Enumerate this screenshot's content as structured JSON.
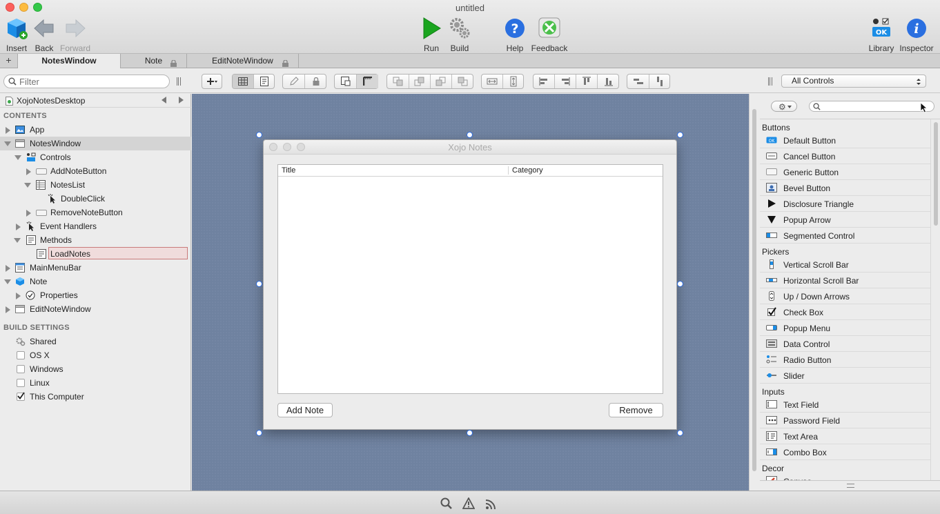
{
  "window": {
    "title": "untitled"
  },
  "toolbar": {
    "insert": "Insert",
    "back": "Back",
    "forward": "Forward",
    "run": "Run",
    "build": "Build",
    "help": "Help",
    "feedback": "Feedback",
    "library": "Library",
    "inspector": "Inspector"
  },
  "tabs": {
    "add": "+",
    "items": [
      {
        "label": "NotesWindow",
        "active": true,
        "locked": false
      },
      {
        "label": "Note",
        "active": false,
        "locked": true
      },
      {
        "label": "EditNoteWindow",
        "active": false,
        "locked": true
      }
    ]
  },
  "filter": {
    "placeholder": "Filter",
    "value": ""
  },
  "library_filter": {
    "selected": "All Controls"
  },
  "navigator": {
    "project": "XojoNotesDesktop",
    "contents_title": "CONTENTS",
    "rows": [
      "App",
      "NotesWindow",
      "Controls",
      "AddNoteButton",
      "NotesList",
      "DoubleClick",
      "RemoveNoteButton",
      "Event Handlers",
      "Methods",
      "LoadNotes",
      "MainMenuBar",
      "Note",
      "Properties",
      "EditNoteWindow"
    ],
    "build_title": "BUILD SETTINGS",
    "build": [
      {
        "label": "Shared"
      },
      {
        "label": "OS X",
        "checked": false
      },
      {
        "label": "Windows",
        "checked": false
      },
      {
        "label": "Linux",
        "checked": false
      },
      {
        "label": "This Computer",
        "checked": true
      }
    ]
  },
  "form": {
    "title": "Xojo Notes",
    "columns": [
      "Title",
      "Category"
    ],
    "add_button": "Add Note",
    "remove_button": "Remove"
  },
  "library": {
    "search_value": "",
    "categories": [
      {
        "name": "Buttons",
        "items": [
          "Default Button",
          "Cancel Button",
          "Generic Button",
          "Bevel Button",
          "Disclosure Triangle",
          "Popup Arrow",
          "Segmented Control"
        ]
      },
      {
        "name": "Pickers",
        "items": [
          "Vertical Scroll Bar",
          "Horizontal Scroll Bar",
          "Up / Down Arrows",
          "Check Box",
          "Popup Menu",
          "Data Control",
          "Radio Button",
          "Slider"
        ]
      },
      {
        "name": "Inputs",
        "items": [
          "Text Field",
          "Password Field",
          "Text Area",
          "Combo Box"
        ]
      },
      {
        "name": "Decor",
        "items": [
          "Canvas"
        ]
      }
    ]
  },
  "colors": {
    "canvas": "#6f82a0",
    "selection_handle": "#2c6ce0",
    "help_blue": "#2a6fe0",
    "run_green": "#1aa51f"
  }
}
